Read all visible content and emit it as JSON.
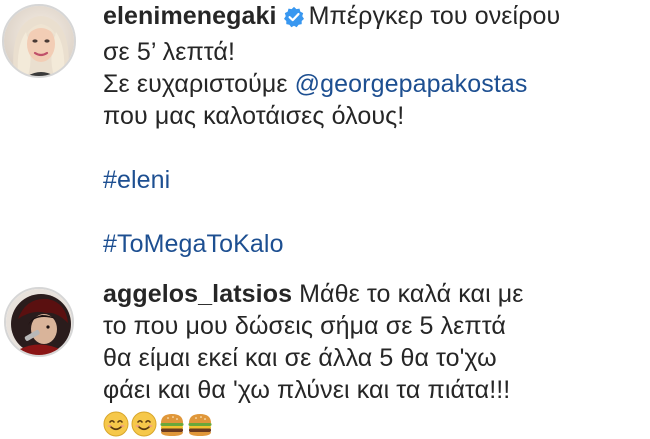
{
  "post": {
    "username": "elenimenegaki",
    "verified_icon": "verified-badge-icon",
    "caption_line1": "Μπέργκερ του ονείρου",
    "caption_line2": "σε 5’ λεπτά!",
    "caption_line3_prefix": "Σε ευχαριστούμε ",
    "mention": "@georgepapakostas",
    "caption_line4": "που μας καλοτάισες όλους!",
    "hashtag1": "#eleni",
    "hashtag2": "#ToMegaToKalo",
    "avatar_icon": "profile-photo-avatar"
  },
  "comment": {
    "username": "aggelos_latsios",
    "line1": "Μάθε το καλά και με",
    "line2": "το που μου δώσεις σήμα σε 5 λεπτά",
    "line3": "θα είμαι εκεί και σε άλλα 5 θα το'χω",
    "line4": "φάει και θα 'χω πλύνει και τα πιάτα!!!",
    "emojis": [
      "smiling-face-icon",
      "smiling-face-icon",
      "hamburger-icon",
      "hamburger-icon"
    ],
    "avatar_icon": "profile-photo-avatar"
  },
  "colors": {
    "text": "#262626",
    "link": "#1d4f91",
    "verified": "#3897f0"
  }
}
